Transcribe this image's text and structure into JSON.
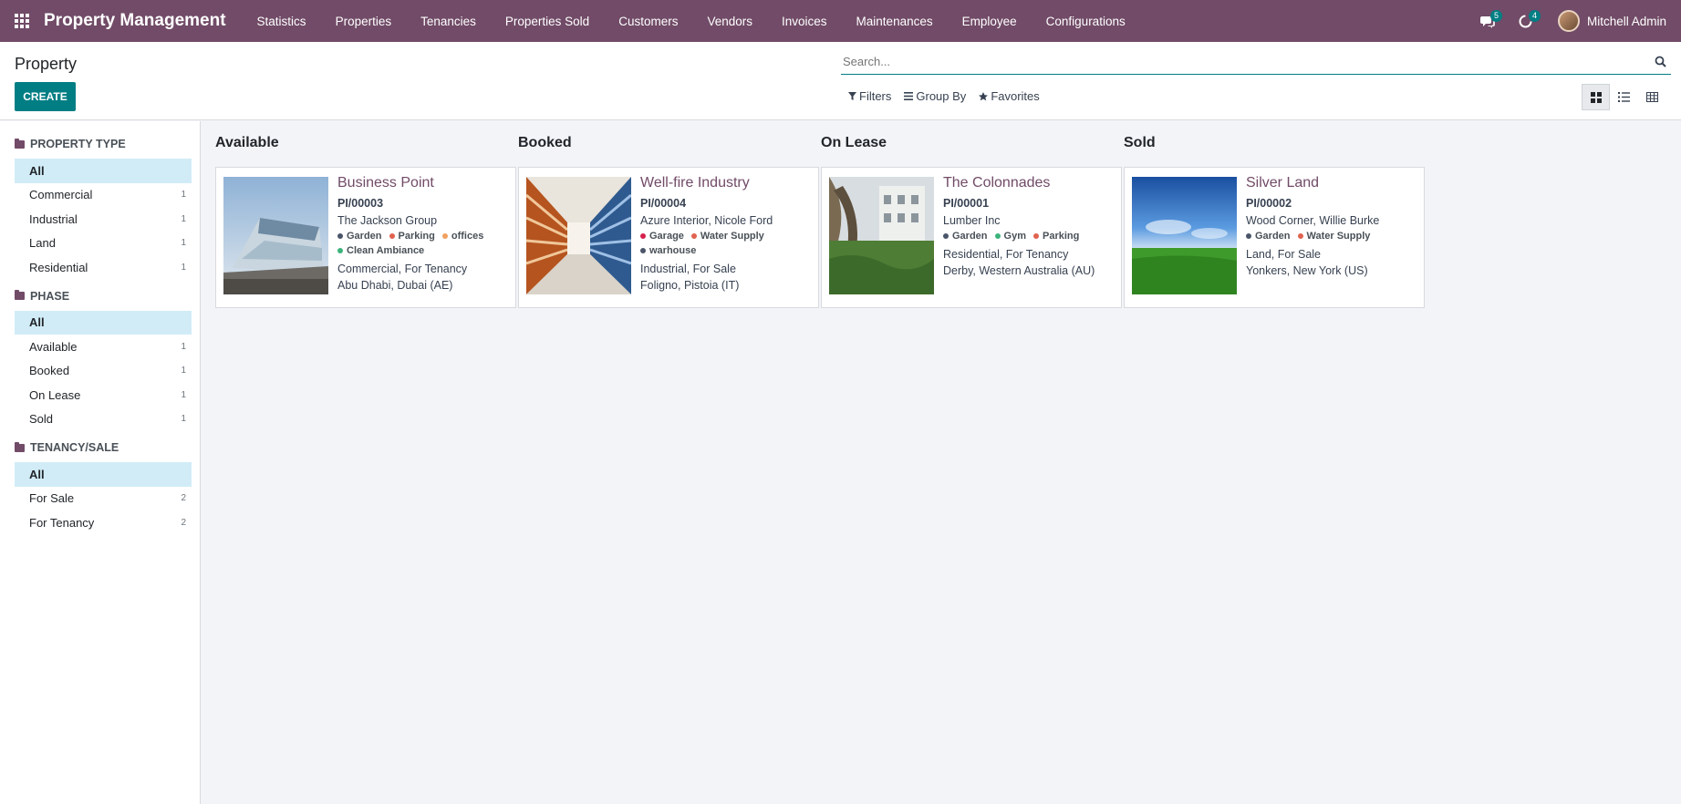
{
  "navbar": {
    "brand": "Property Management",
    "menu": [
      "Statistics",
      "Properties",
      "Tenancies",
      "Properties Sold",
      "Customers",
      "Vendors",
      "Invoices",
      "Maintenances",
      "Employee",
      "Configurations"
    ],
    "messages_badge": "5",
    "activities_badge": "4",
    "user": "Mitchell Admin",
    "bar_color": "#714b67"
  },
  "control_panel": {
    "title": "Property",
    "create_label": "CREATE",
    "search_placeholder": "Search...",
    "filters_label": "Filters",
    "group_by_label": "Group By",
    "favorites_label": "Favorites",
    "active_view": "kanban"
  },
  "sidebar": {
    "sections": [
      {
        "title": "PROPERTY TYPE",
        "items": [
          {
            "label": "All",
            "count": "",
            "active": true
          },
          {
            "label": "Commercial",
            "count": "1"
          },
          {
            "label": "Industrial",
            "count": "1"
          },
          {
            "label": "Land",
            "count": "1"
          },
          {
            "label": "Residential",
            "count": "1"
          }
        ]
      },
      {
        "title": "PHASE",
        "items": [
          {
            "label": "All",
            "count": "",
            "active": true
          },
          {
            "label": "Available",
            "count": "1"
          },
          {
            "label": "Booked",
            "count": "1"
          },
          {
            "label": "On Lease",
            "count": "1"
          },
          {
            "label": "Sold",
            "count": "1"
          }
        ]
      },
      {
        "title": "TENANCY/SALE",
        "items": [
          {
            "label": "All",
            "count": "",
            "active": true
          },
          {
            "label": "For Sale",
            "count": "2"
          },
          {
            "label": "For Tenancy",
            "count": "2"
          }
        ]
      }
    ]
  },
  "kanban": {
    "columns": [
      {
        "title": "Available",
        "card": {
          "name": "Business Point",
          "ref": "PI/00003",
          "owner": "The Jackson Group",
          "tags": [
            {
              "label": "Garden",
              "color": "#4a5568"
            },
            {
              "label": "Parking",
              "color": "#e0624f"
            },
            {
              "label": "offices",
              "color": "#f0a060"
            },
            {
              "label": "Clean Ambiance",
              "color": "#3cb37b"
            }
          ],
          "type_line": "Commercial, For Tenancy",
          "location": "Abu Dhabi, Dubai (AE)",
          "image": "building-photo"
        }
      },
      {
        "title": "Booked",
        "card": {
          "name": "Well-fire Industry",
          "ref": "PI/00004",
          "owner": "Azure Interior, Nicole Ford",
          "tags": [
            {
              "label": "Garage",
              "color": "#d6204d"
            },
            {
              "label": "Water Supply",
              "color": "#e0624f"
            },
            {
              "label": "warhouse",
              "color": "#4a5568"
            }
          ],
          "type_line": "Industrial, For Sale",
          "location": "Foligno, Pistoia (IT)",
          "image": "warehouse-photo"
        }
      },
      {
        "title": "On Lease",
        "card": {
          "name": "The Colonnades",
          "ref": "PI/00001",
          "owner": "Lumber Inc",
          "tags": [
            {
              "label": "Garden",
              "color": "#4a5568"
            },
            {
              "label": "Gym",
              "color": "#3cb37b"
            },
            {
              "label": "Parking",
              "color": "#e0624f"
            }
          ],
          "type_line": "Residential, For Tenancy",
          "location": "Derby, Western Australia (AU)",
          "image": "garden-photo"
        }
      },
      {
        "title": "Sold",
        "card": {
          "name": "Silver Land",
          "ref": "PI/00002",
          "owner": "Wood Corner, Willie Burke",
          "tags": [
            {
              "label": "Garden",
              "color": "#4a5568"
            },
            {
              "label": "Water Supply",
              "color": "#e0624f"
            }
          ],
          "type_line": "Land, For Sale",
          "location": "Yonkers, New York (US)",
          "image": "field-photo"
        }
      }
    ]
  }
}
